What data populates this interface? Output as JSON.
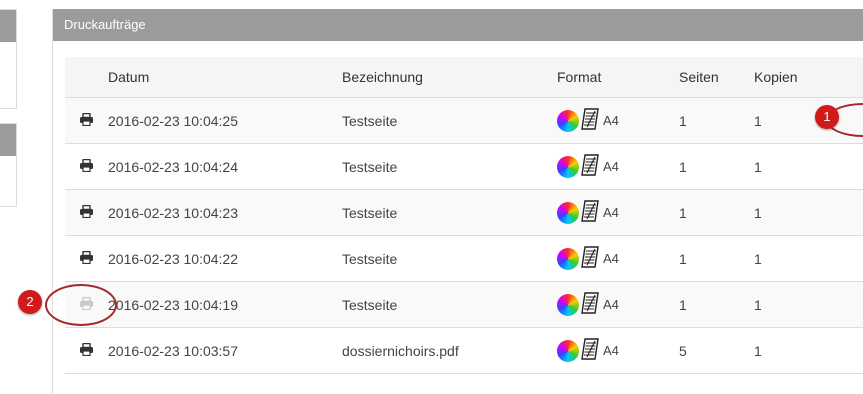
{
  "panel": {
    "title": "Druckaufträge"
  },
  "table": {
    "headers": [
      "",
      "Datum",
      "Bezeichnung",
      "Format",
      "Seiten",
      "Kopien"
    ],
    "rows": [
      {
        "icon": "printer-icon",
        "date": "2016-02-23 10:04:25",
        "name": "Testseite",
        "format": "A4",
        "pages": "1",
        "copies": "1",
        "icon_state": "active"
      },
      {
        "icon": "printer-icon",
        "date": "2016-02-23 10:04:24",
        "name": "Testseite",
        "format": "A4",
        "pages": "1",
        "copies": "1",
        "icon_state": "active"
      },
      {
        "icon": "printer-icon",
        "date": "2016-02-23 10:04:23",
        "name": "Testseite",
        "format": "A4",
        "pages": "1",
        "copies": "1",
        "icon_state": "active"
      },
      {
        "icon": "printer-icon",
        "date": "2016-02-23 10:04:22",
        "name": "Testseite",
        "format": "A4",
        "pages": "1",
        "copies": "1",
        "icon_state": "active"
      },
      {
        "icon": "printer-icon",
        "date": "2016-02-23 10:04:19",
        "name": "Testseite",
        "format": "A4",
        "pages": "1",
        "copies": "1",
        "icon_state": "disabled"
      },
      {
        "icon": "printer-icon",
        "date": "2016-02-23 10:03:57",
        "name": "dossiernichoirs.pdf",
        "format": "A4",
        "pages": "5",
        "copies": "1",
        "icon_state": "active"
      }
    ]
  },
  "callouts": [
    {
      "label": "1"
    },
    {
      "label": "2"
    }
  ],
  "colors": {
    "header_bg": "#9b9b9b",
    "callout": "#d11a1a",
    "icon_active": "#333333",
    "icon_disabled": "#c8c8c8"
  }
}
